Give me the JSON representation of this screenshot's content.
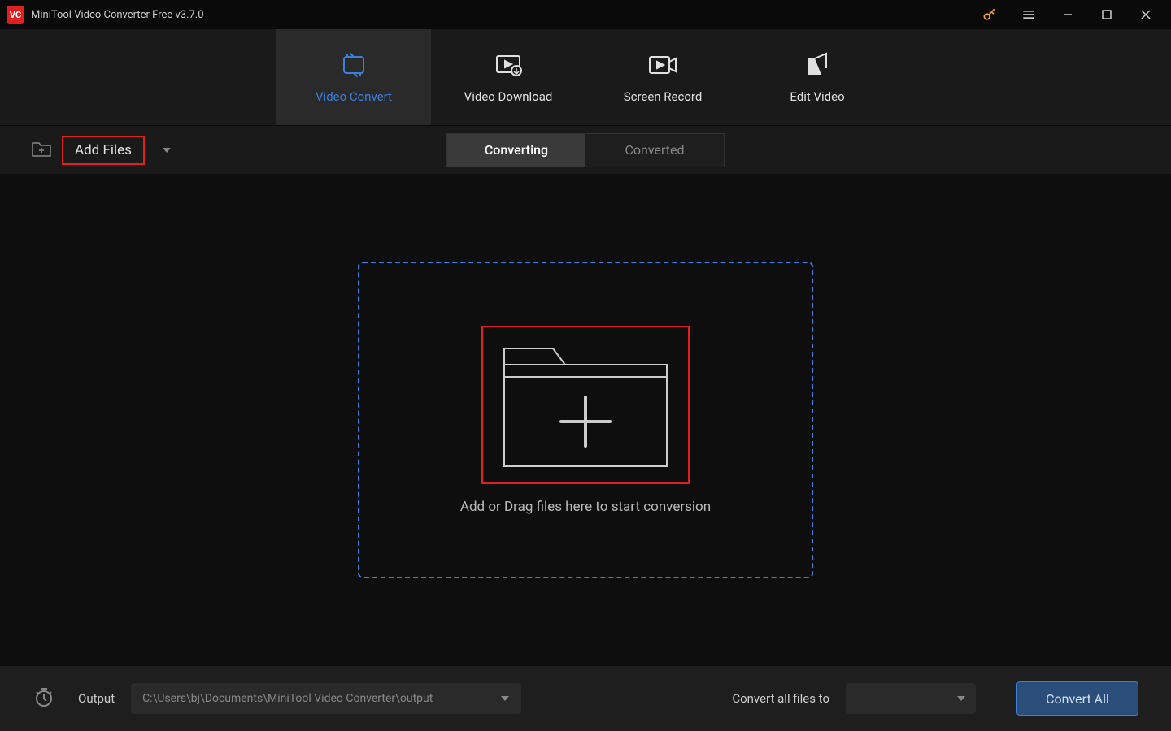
{
  "titlebar": {
    "logo_text": "VC",
    "title": "MiniTool Video Converter Free v3.7.0"
  },
  "nav": {
    "items": [
      {
        "label": "Video Convert"
      },
      {
        "label": "Video Download"
      },
      {
        "label": "Screen Record"
      },
      {
        "label": "Edit Video"
      }
    ]
  },
  "toolbar": {
    "add_files_label": "Add Files",
    "tabs": {
      "converting": "Converting",
      "converted": "Converted"
    }
  },
  "dropzone": {
    "text": "Add or Drag files here to start conversion"
  },
  "footer": {
    "output_label": "Output",
    "output_path": "C:\\Users\\bj\\Documents\\MiniTool Video Converter\\output",
    "convert_all_label": "Convert all files to",
    "convert_all_btn": "Convert All"
  }
}
